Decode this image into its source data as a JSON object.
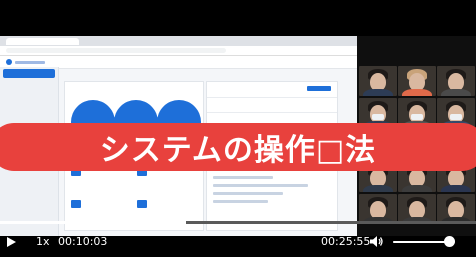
{
  "overlay": {
    "caption": "システムの操作□法"
  },
  "player": {
    "speed": "1x",
    "current_time": "00:10:03",
    "duration": "00:25:55",
    "progress_fraction": 0.39,
    "volume_fraction": 0.9
  },
  "colors": {
    "banner": "#e8413d",
    "accent": "#1e6fd9"
  },
  "icons": [
    "play-icon",
    "volume-icon"
  ]
}
